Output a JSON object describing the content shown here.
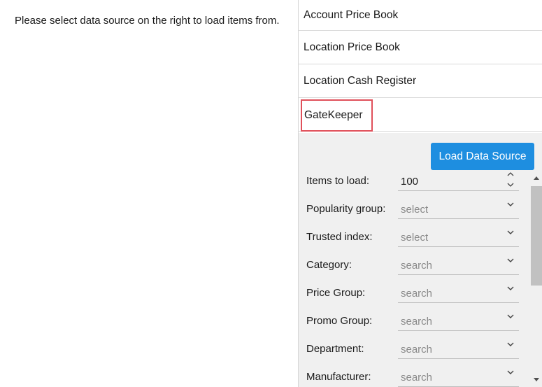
{
  "message": "Please select data source on the right to load items from.",
  "data_sources": [
    {
      "label": "Account Price Book"
    },
    {
      "label": "Location Price Book"
    },
    {
      "label": "Location Cash Register"
    },
    {
      "label": "GateKeeper",
      "selected": true
    }
  ],
  "load_button": "Load Data Source",
  "fields": [
    {
      "label": "Items to load:",
      "value": "100",
      "kind": "number"
    },
    {
      "label": "Popularity group:",
      "value": "select",
      "kind": "select"
    },
    {
      "label": "Trusted index:",
      "value": "select",
      "kind": "select"
    },
    {
      "label": "Category:",
      "value": "search",
      "kind": "search"
    },
    {
      "label": "Price Group:",
      "value": "search",
      "kind": "search"
    },
    {
      "label": "Promo Group:",
      "value": "search",
      "kind": "search"
    },
    {
      "label": "Department:",
      "value": "search",
      "kind": "search"
    },
    {
      "label": "Manufacturer:",
      "value": "search",
      "kind": "search"
    }
  ],
  "colors": {
    "accent": "#1e8ee0",
    "selection_border": "#e0505a",
    "panel_bg": "#f0f0f0"
  }
}
